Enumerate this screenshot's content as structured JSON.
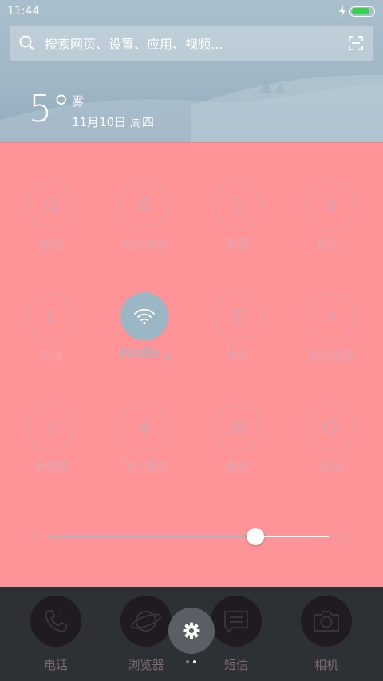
{
  "status_bar": {
    "time": "11:44",
    "battery_level": 0.85,
    "charging": true
  },
  "search": {
    "placeholder": "搜索网页、设置、应用、视频..."
  },
  "weather": {
    "temperature": "5°",
    "condition": "雾",
    "date": "11月10日 周四"
  },
  "toggles": [
    {
      "label": "静音",
      "icon": "bell-off-icon",
      "state": "off"
    },
    {
      "label": "方向锁定",
      "icon": "rotation-lock-icon",
      "state": "off"
    },
    {
      "label": "锁屏",
      "icon": "padlock-icon",
      "state": "off"
    },
    {
      "label": "蓝牙",
      "icon": "bluetooth-icon",
      "state": "off",
      "has_menu": true
    },
    {
      "label": "数据",
      "icon": "data-arrows-icon",
      "state": "disabled"
    },
    {
      "label": "MIOffic",
      "icon": "wifi-icon",
      "state": "on",
      "has_menu": true
    },
    {
      "label": "快传",
      "icon": "upload-icon",
      "state": "off"
    },
    {
      "label": "自动亮度",
      "icon": "auto-brightness-icon",
      "state": "off"
    },
    {
      "label": "手电筒",
      "icon": "flashlight-icon",
      "state": "off"
    },
    {
      "label": "飞行模式",
      "icon": "airplane-icon",
      "state": "off"
    },
    {
      "label": "截屏",
      "icon": "screenshot-icon",
      "state": "off"
    },
    {
      "label": "振动",
      "icon": "vibrate-icon",
      "state": "off"
    }
  ],
  "brightness": {
    "level": 0.74
  },
  "dock": [
    {
      "label": "电话",
      "icon": "phone-icon"
    },
    {
      "label": "浏览器",
      "icon": "browser-globe-icon"
    },
    {
      "label": "短信",
      "icon": "message-icon"
    },
    {
      "label": "相机",
      "icon": "camera-icon"
    }
  ],
  "pager": {
    "pages": 2,
    "current": 1
  },
  "colors": {
    "panel": "#fe9497",
    "icon_outline": "#dba1ad",
    "active": "#9bb7c6",
    "battery": "#39d04a",
    "dock": "#2d3136"
  }
}
